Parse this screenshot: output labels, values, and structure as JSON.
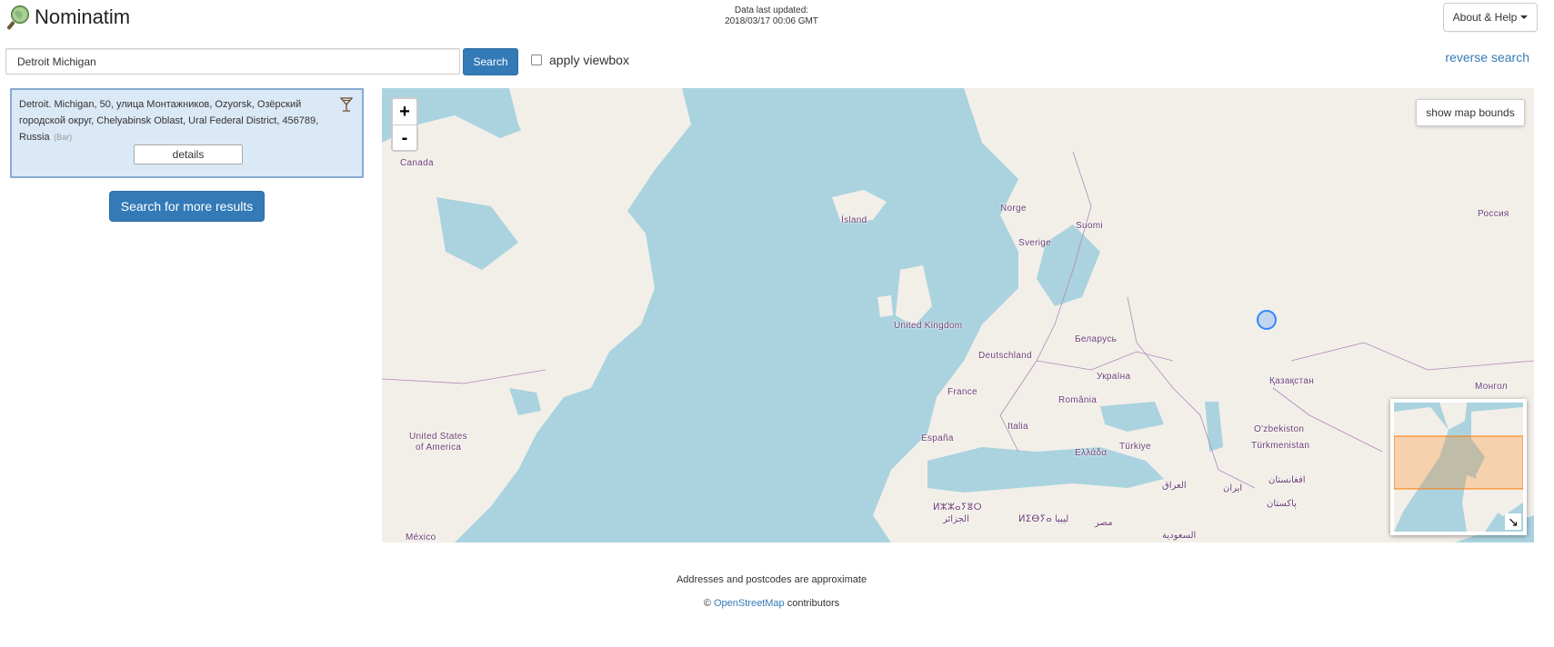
{
  "header": {
    "app_name": "Nominatim",
    "logo_icon": "magnifier-globe-icon",
    "last_updated_label": "Data last updated:",
    "last_updated_value": "2018/03/17 00:06 GMT",
    "about_label": "About & Help"
  },
  "search": {
    "query": "Detroit Michigan",
    "button_label": "Search",
    "viewbox_label": "apply viewbox",
    "viewbox_checked": false,
    "reverse_label": "reverse search"
  },
  "results": [
    {
      "name": "Detroit. Michigan, 50, улица Монтажников, Ozyorsk, Озёрский городской округ, Chelyabinsk Oblast, Ural Federal District, 456789, Russia",
      "type": "(Bar)",
      "icon": "cocktail-glass-icon",
      "details_label": "details"
    }
  ],
  "more_results_label": "Search for more results",
  "map": {
    "zoom_in_label": "+",
    "zoom_out_label": "-",
    "show_bounds_label": "show map bounds",
    "minimap_toggle_label": "↘",
    "labels": {
      "canada": "Canada",
      "island": "Ísland",
      "norge": "Norge",
      "suomi": "Suomi",
      "sverige": "Sverige",
      "rossiya": "Россия",
      "uk": "United Kingdom",
      "belarus": "Беларусь",
      "deutschland": "Deutschland",
      "ukraina": "Україна",
      "kazakhstan": "Қазақстан",
      "mongol": "Монгол",
      "france": "France",
      "romania": "România",
      "usa_1": "United States",
      "usa_2": "of America",
      "italia": "Italia",
      "uzbekiston": "O'zbekiston",
      "espana": "España",
      "ellada": "Ελλάδα",
      "turkiye": "Türkiye",
      "turkmenistan": "Türkmenistan",
      "afghanistan": "افغانستان",
      "iraq": "العراق",
      "iran": "ایران",
      "pakistan": "پاکستان",
      "algeria_1": "ⵍⵣⵣⴰⵢⴻⵔ",
      "algeria_2": "الجزائر",
      "libya": "ⵍⵉⴱⵢⴰ ليبيا",
      "misr": "مصر",
      "saudi": "السعودية",
      "mexico": "México"
    },
    "colors": {
      "water": "#aad3df",
      "land": "#f2efe9",
      "border": "#b088b8",
      "marker": "#3388ff",
      "bounds": "#ff7800"
    }
  },
  "footer": {
    "note": "Addresses and postcodes are approximate",
    "copy_prefix": "©",
    "osm_link": "OpenStreetMap",
    "copy_suffix": "contributors"
  }
}
